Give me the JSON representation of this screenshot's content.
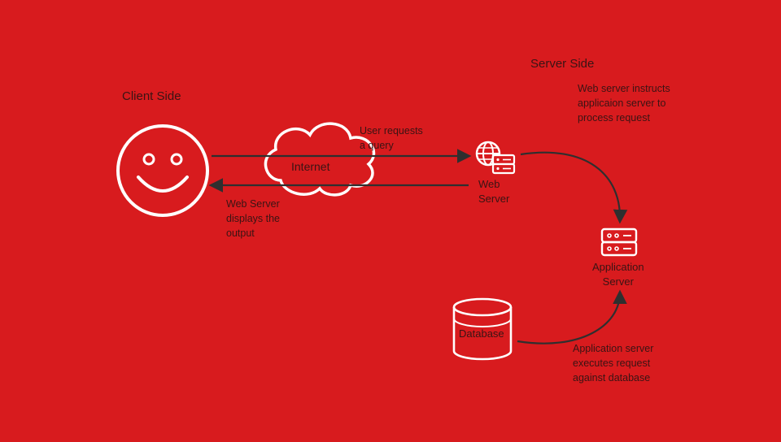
{
  "headings": {
    "client": "Client Side",
    "server": "Server Side"
  },
  "nodes": {
    "internet": "Internet",
    "web_server": "Web\nServer",
    "application_server": "Application\nServer",
    "database": "Database"
  },
  "annotations": {
    "user_requests": "User requests\na query",
    "displays_output": "Web Server\ndisplays the\noutput",
    "instructs": "Web server instructs\napplicaion server to\nprocess request",
    "executes": "Application server\nexecutes request\nagainst database"
  },
  "colors": {
    "bg": "#D81B1E",
    "stroke_dark": "#2f2f2f",
    "stroke_light": "#ffffff"
  }
}
